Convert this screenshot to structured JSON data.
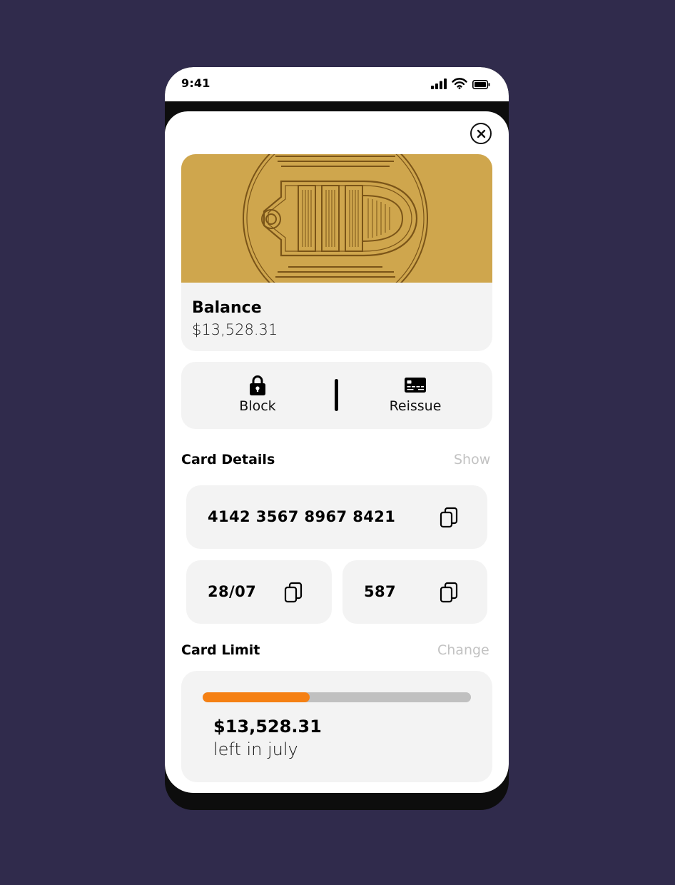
{
  "status_bar": {
    "time": "9:41"
  },
  "balance": {
    "label": "Balance",
    "value": "$13,528.31"
  },
  "actions": {
    "block": {
      "label": "Block",
      "icon": "lock-icon"
    },
    "reissue": {
      "label": "Reissue",
      "icon": "credit-card-icon"
    }
  },
  "card_details": {
    "title": "Card Details",
    "action": "Show",
    "number": "4142 3567 8967 8421",
    "expiry": "28/07",
    "cvv": "587"
  },
  "card_limit": {
    "title": "Card Limit",
    "action": "Change",
    "amount": "$13,528.31",
    "subtitle": "left in july",
    "progress_fraction": 0.4
  },
  "colors": {
    "background": "#302b4c",
    "card_gold": "#cfa64d",
    "progress": "#f58013",
    "panel": "#f3f3f3"
  }
}
